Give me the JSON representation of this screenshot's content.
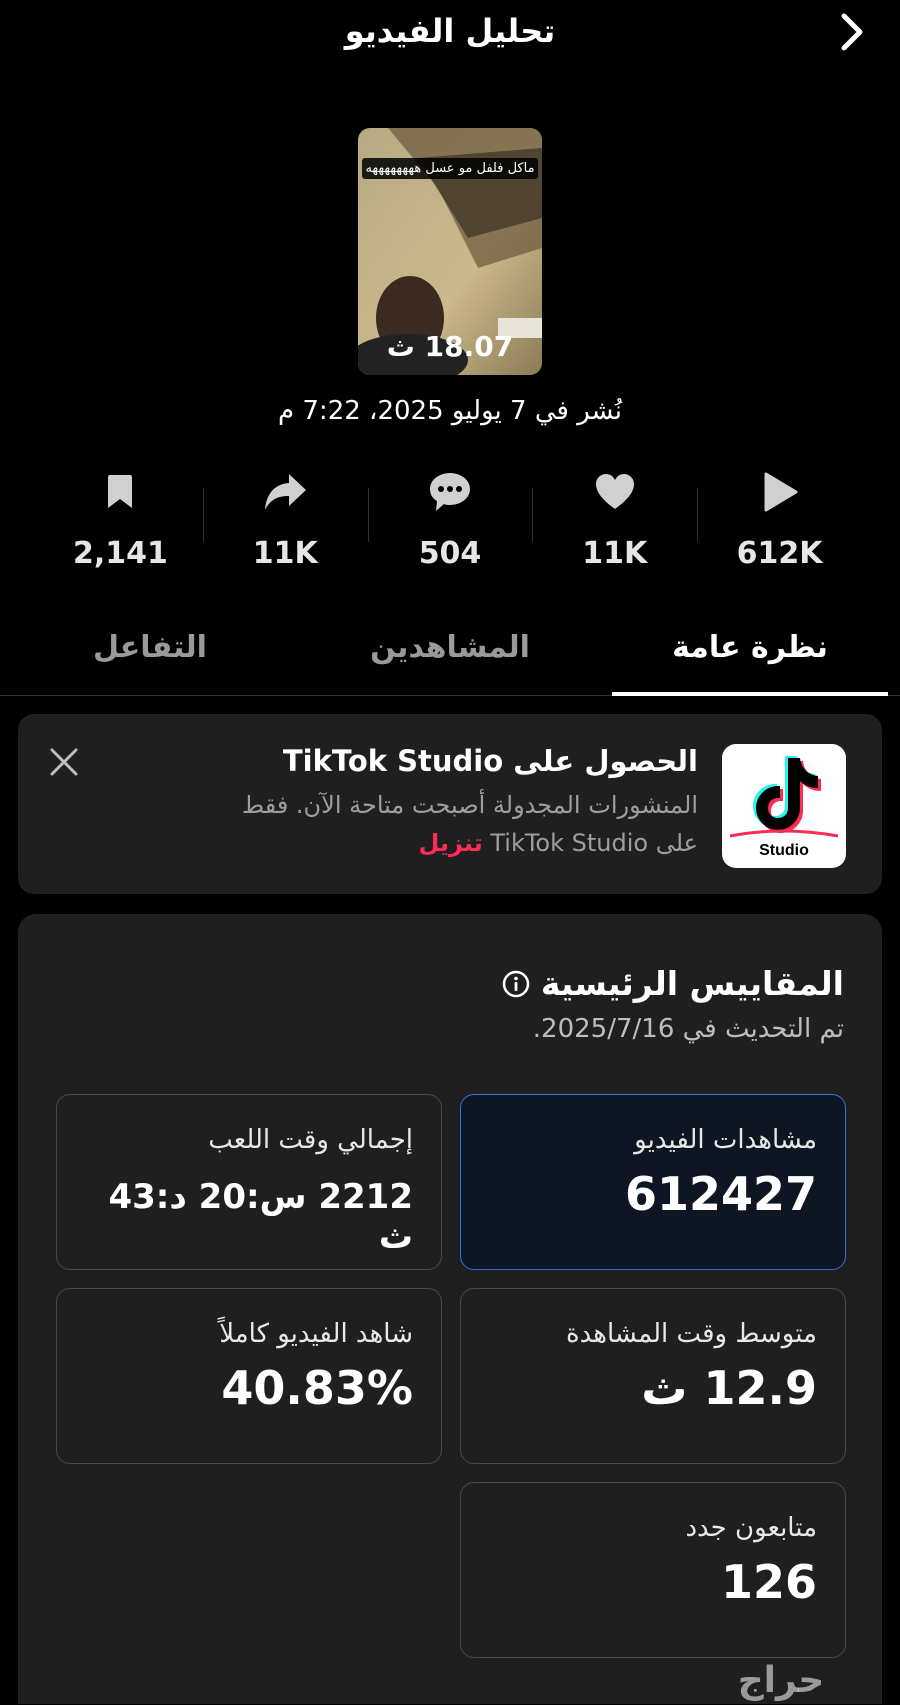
{
  "header": {
    "title": "تحليل الفيديو"
  },
  "video": {
    "caption": "ماكل فلفل مو عسل ههههههههه",
    "duration": "18.07 ث",
    "posted": "نُشر في 7 يوليو 2025، 7:22 م"
  },
  "stats": [
    {
      "icon": "play-icon",
      "value": "612K"
    },
    {
      "icon": "heart-icon",
      "value": "11K"
    },
    {
      "icon": "comment-icon",
      "value": "504"
    },
    {
      "icon": "share-icon",
      "value": "11K"
    },
    {
      "icon": "bookmark-icon",
      "value": "2,141"
    }
  ],
  "tabs": [
    {
      "label": "نظرة عامة",
      "active": true
    },
    {
      "label": "المشاهدين",
      "active": false
    },
    {
      "label": "التفاعل",
      "active": false
    }
  ],
  "promo": {
    "title": "الحصول على TikTok Studio",
    "desc": "المنشورات المجدولة أصبحت متاحة الآن. فقط على TikTok Studio",
    "link": "تنزيل",
    "logo_label": "Studio"
  },
  "metrics": {
    "title": "المقاييس الرئيسية",
    "updated": "تم التحديث في 2025/7/16.",
    "cards": {
      "views": {
        "label": "مشاهدات الفيديو",
        "value": "612427"
      },
      "playtime": {
        "label": "إجمالي وقت اللعب",
        "value": "2212 س:20 د:43 ث"
      },
      "avg_watch": {
        "label": "متوسط وقت المشاهدة",
        "value": "12.9 ث"
      },
      "full_watch": {
        "label": "شاهد الفيديو كاملاً",
        "value": "40.83%"
      },
      "new_followers": {
        "label": "متابعون جدد",
        "value": "126"
      }
    }
  },
  "watermark": "حراج",
  "colors": {
    "accent": "#fe2c55",
    "selected_border": "#3a6fd6",
    "card_bg": "#1f1f1f"
  }
}
